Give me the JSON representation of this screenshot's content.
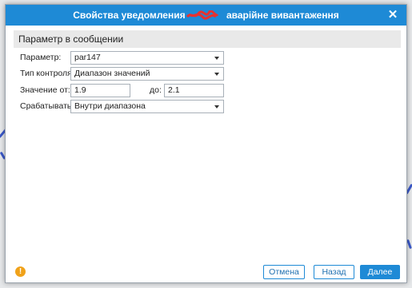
{
  "dialog": {
    "title": "Свойства уведомления – ",
    "title_suffix": "аварійне вивантаження",
    "close_glyph": "✕"
  },
  "section": {
    "header": "Параметр в сообщении"
  },
  "form": {
    "parameter": {
      "label": "Параметр:",
      "value": "par147"
    },
    "control_type": {
      "label": "Тип контроля:",
      "value": "Диапазон значений"
    },
    "value_from": {
      "label": "Значение от:",
      "value": "1.9"
    },
    "value_to": {
      "label": "до:",
      "value": "2.1"
    },
    "trigger": {
      "label": "Срабатывать:",
      "value": "Внутри диапазона"
    }
  },
  "footer": {
    "warning_glyph": "!",
    "cancel_label": "Отмена",
    "back_label": "Назад",
    "next_label": "Далее"
  },
  "colors": {
    "accent": "#1e8ad6",
    "warning": "#f0a21a",
    "redaction": "#e8312f"
  }
}
